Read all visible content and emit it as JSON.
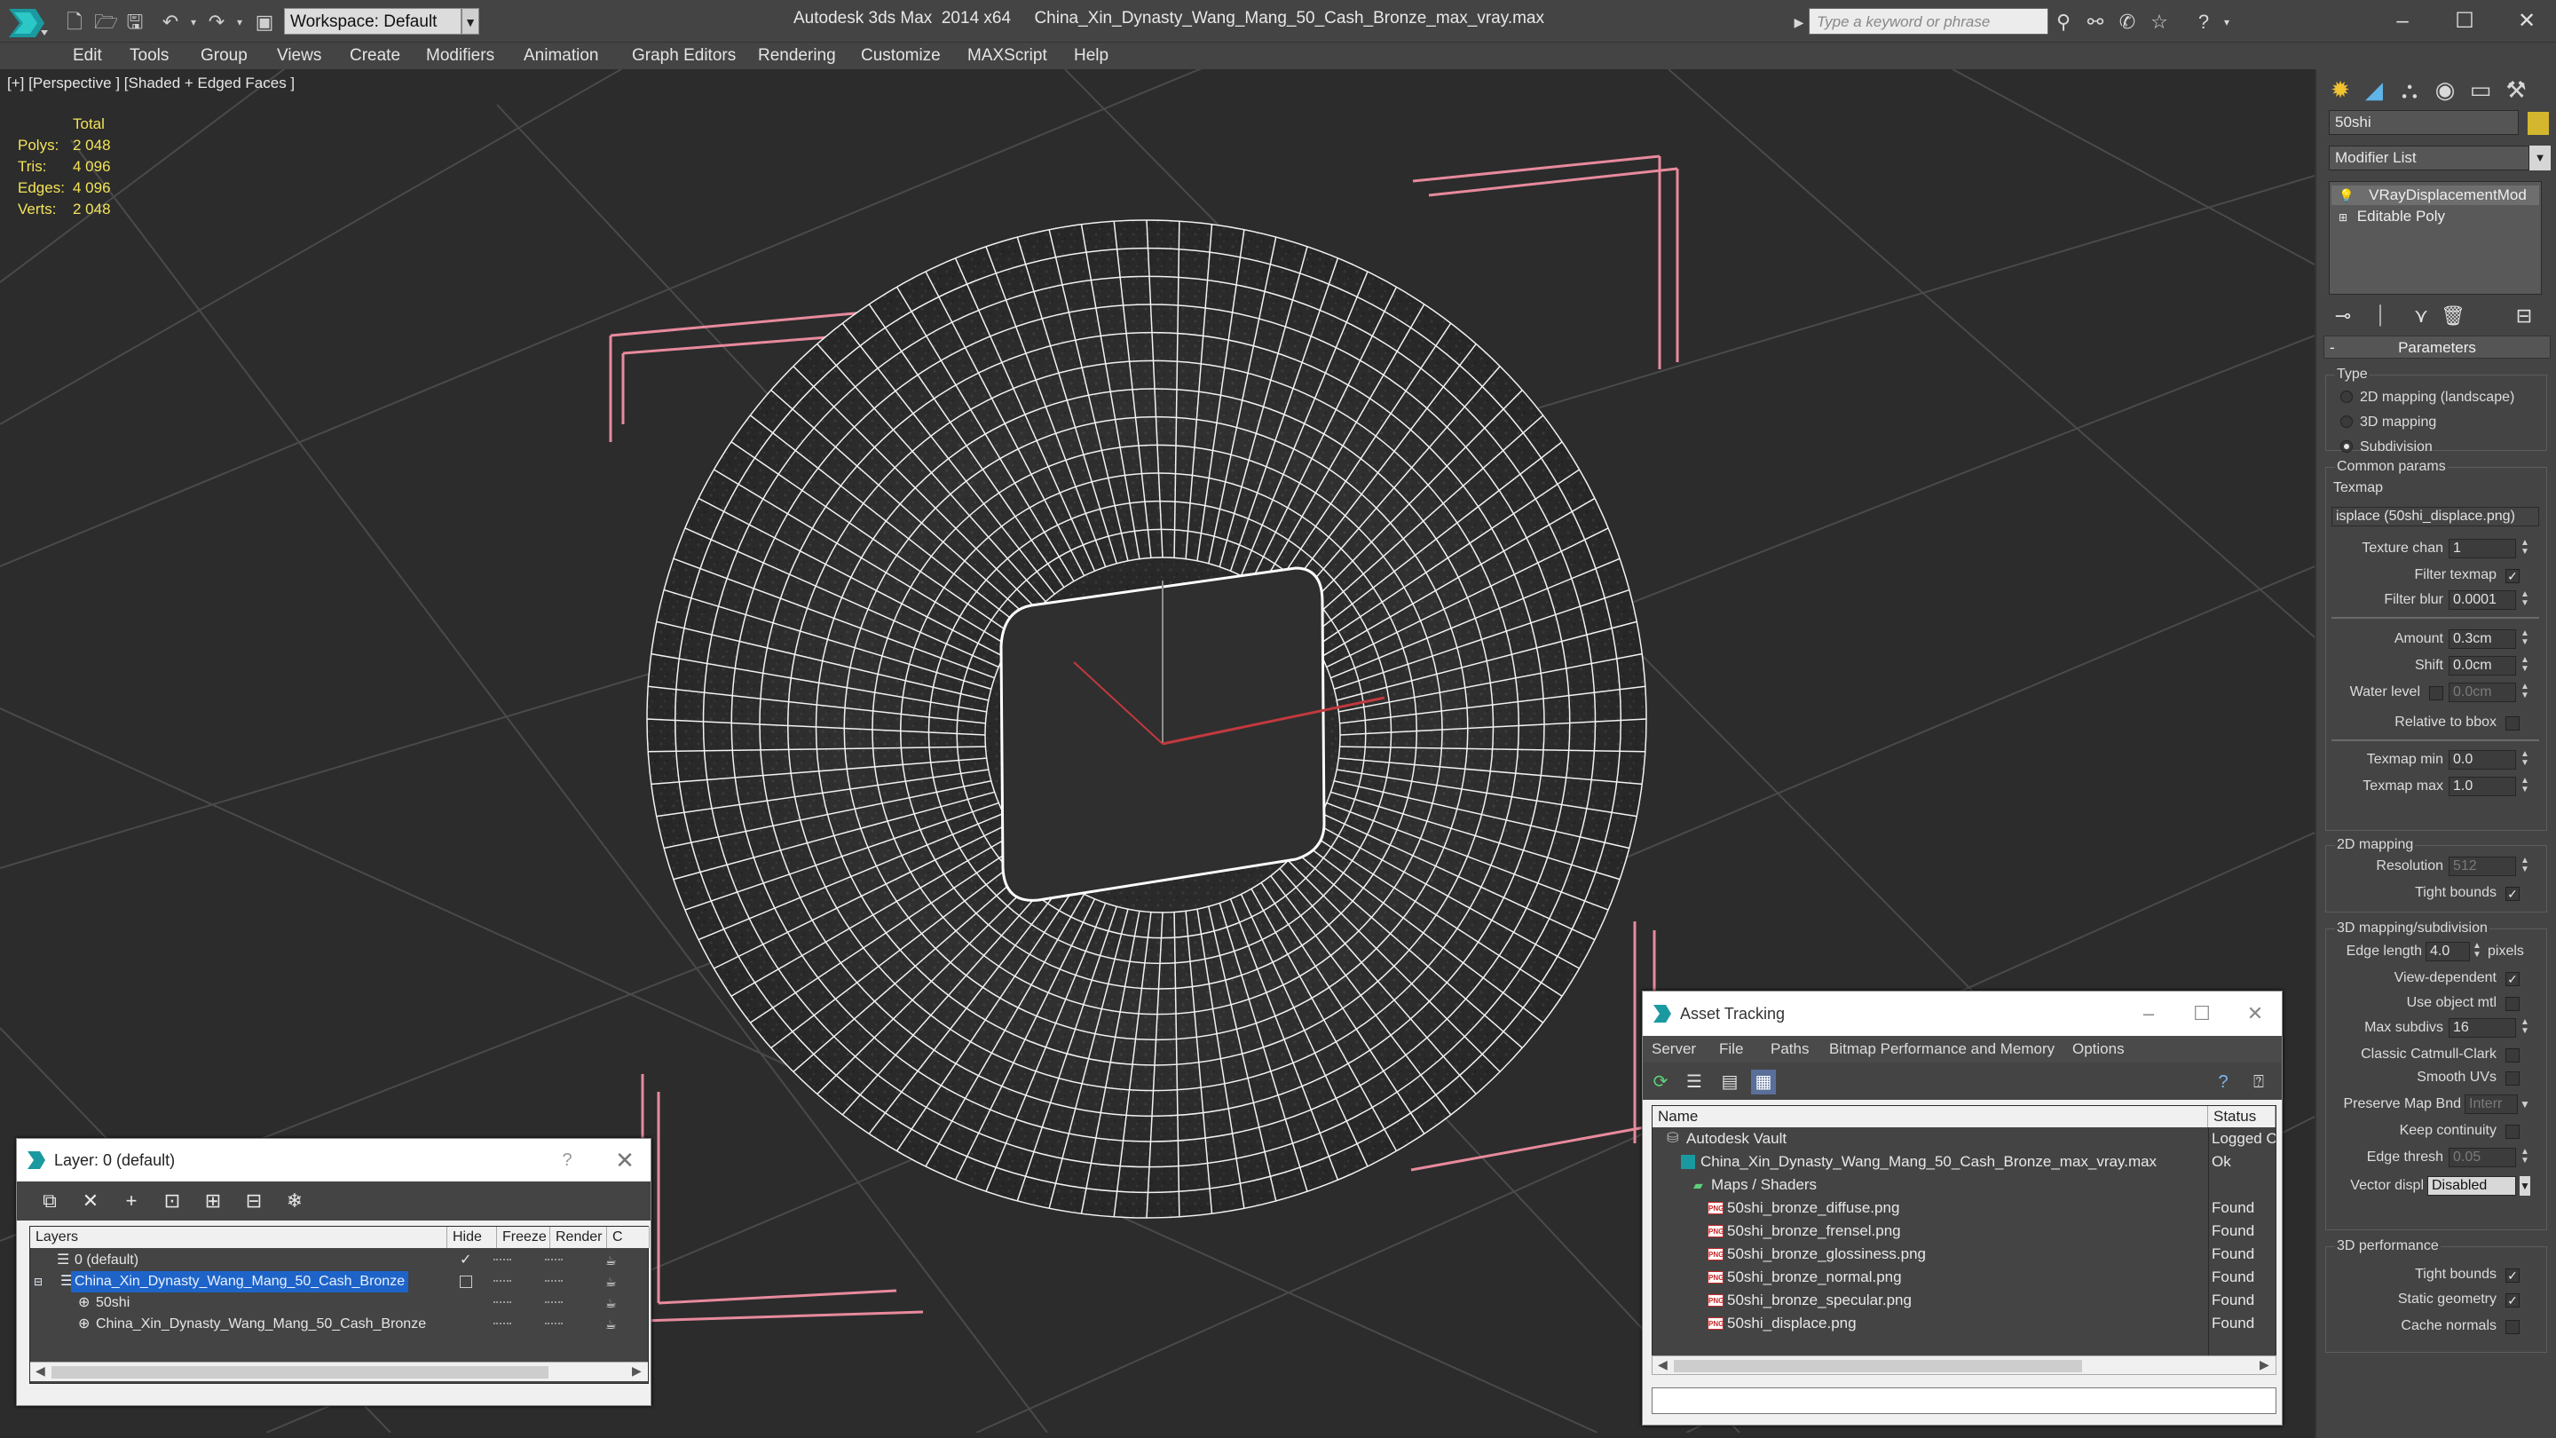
{
  "window": {
    "app_title": "Autodesk 3ds Max  2014 x64",
    "file_title": "China_Xin_Dynasty_Wang_Mang_50_Cash_Bronze_max_vray.max",
    "workspace": "Workspace: Default",
    "search_placeholder": "Type a keyword or phrase"
  },
  "menu": [
    "Edit",
    "Tools",
    "Group",
    "Views",
    "Create",
    "Modifiers",
    "Animation",
    "Graph Editors",
    "Rendering",
    "Customize",
    "MAXScript",
    "Help"
  ],
  "viewport": {
    "label": "[+] [Perspective ] [Shaded + Edged Faces ]",
    "stats": {
      "header": "Total",
      "rows": [
        {
          "label": "Polys:",
          "value": "2 048"
        },
        {
          "label": "Tris:",
          "value": "4 096"
        },
        {
          "label": "Edges:",
          "value": "4 096"
        },
        {
          "label": "Verts:",
          "value": "2 048"
        }
      ]
    }
  },
  "command_panel": {
    "object_name": "50shi",
    "object_color": "#d4b72f",
    "modifier_list": "Modifier List",
    "stack": [
      "VRayDisplacementMod",
      "Editable Poly"
    ],
    "rollout_title": "Parameters",
    "type_group": "Type",
    "type_options": [
      {
        "label": "2D mapping (landscape)",
        "selected": false
      },
      {
        "label": "3D mapping",
        "selected": false
      },
      {
        "label": "Subdivision",
        "selected": true
      }
    ],
    "common_group": "Common params",
    "texmap_label": "Texmap",
    "texmap_value": "isplace (50shi_displace.png)",
    "texture_chan_label": "Texture chan",
    "texture_chan": "1",
    "filter_texmap_label": "Filter texmap",
    "filter_blur_label": "Filter blur",
    "filter_blur": "0.0001",
    "amount_label": "Amount",
    "amount": "0.3cm",
    "shift_label": "Shift",
    "shift": "0.0cm",
    "water_level_label": "Water level",
    "water_level": "0.0cm",
    "relative_bbox_label": "Relative to bbox",
    "texmap_min_label": "Texmap min",
    "texmap_min": "0.0",
    "texmap_max_label": "Texmap max",
    "texmap_max": "1.0",
    "mapping2d_group": "2D mapping",
    "resolution_label": "Resolution",
    "resolution": "512",
    "tight_bounds_label": "Tight bounds",
    "mapping3d_group": "3D mapping/subdivision",
    "edge_length_label": "Edge length",
    "edge_length": "4.0",
    "pixels_label": "pixels",
    "view_dependent_label": "View-dependent",
    "use_object_mtl_label": "Use object mtl",
    "max_subdivs_label": "Max subdivs",
    "max_subdivs": "16",
    "catmull_label": "Classic Catmull-Clark",
    "smooth_uvs_label": "Smooth UVs",
    "preserve_map_label": "Preserve Map Bnd",
    "preserve_map_value": "Interr",
    "keep_continuity_label": "Keep continuity",
    "edge_thresh_label": "Edge thresh",
    "edge_thresh": "0.05",
    "vector_displ_label": "Vector displ",
    "vector_displ": "Disabled",
    "perf_group": "3D performance",
    "perf_tight_bounds_label": "Tight bounds",
    "static_geometry_label": "Static geometry",
    "cache_normals_label": "Cache normals"
  },
  "layer_window": {
    "title": "Layer: 0 (default)",
    "help": "?",
    "columns": [
      "Layers",
      "Hide",
      "Freeze",
      "Render",
      "C"
    ],
    "rows": [
      {
        "name": "0 (default)",
        "indent": 0,
        "selected": false,
        "check": "✓"
      },
      {
        "name": "China_Xin_Dynasty_Wang_Mang_50_Cash_Bronze",
        "indent": 0,
        "selected": true,
        "check": ""
      },
      {
        "name": "50shi",
        "indent": 1,
        "selected": false,
        "check": ""
      },
      {
        "name": "China_Xin_Dynasty_Wang_Mang_50_Cash_Bronze",
        "indent": 1,
        "selected": false,
        "check": ""
      }
    ]
  },
  "asset_window": {
    "title": "Asset Tracking",
    "menu": [
      "Server",
      "File",
      "Paths",
      "Bitmap Performance and Memory",
      "Options"
    ],
    "columns": [
      "Name",
      "Status"
    ],
    "rows": [
      {
        "name": "Autodesk Vault",
        "status": "Logged O",
        "indent": 0,
        "icon": "vault"
      },
      {
        "name": "China_Xin_Dynasty_Wang_Mang_50_Cash_Bronze_max_vray.max",
        "status": "Ok",
        "indent": 1,
        "icon": "file"
      },
      {
        "name": "Maps / Shaders",
        "status": "",
        "indent": 2,
        "icon": "folder"
      },
      {
        "name": "50shi_bronze_diffuse.png",
        "status": "Found",
        "indent": 3,
        "icon": "png"
      },
      {
        "name": "50shi_bronze_frensel.png",
        "status": "Found",
        "indent": 3,
        "icon": "png"
      },
      {
        "name": "50shi_bronze_glossiness.png",
        "status": "Found",
        "indent": 3,
        "icon": "png"
      },
      {
        "name": "50shi_bronze_normal.png",
        "status": "Found",
        "indent": 3,
        "icon": "png"
      },
      {
        "name": "50shi_bronze_specular.png",
        "status": "Found",
        "indent": 3,
        "icon": "png"
      },
      {
        "name": "50shi_displace.png",
        "status": "Found",
        "indent": 3,
        "icon": "png"
      }
    ]
  }
}
